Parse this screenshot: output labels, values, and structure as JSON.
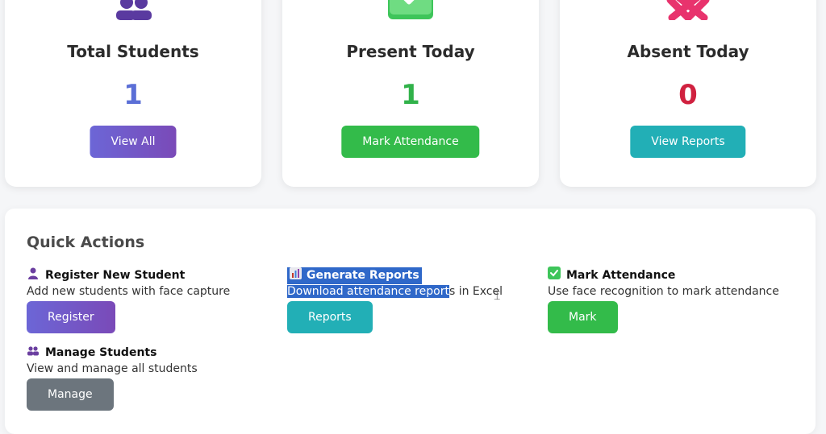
{
  "stats": [
    {
      "title": "Total Students",
      "count": "1",
      "button": "View All",
      "icon": "users-icon",
      "count_color": "#5b6fd6"
    },
    {
      "title": "Present Today",
      "count": "1",
      "button": "Mark Attendance",
      "icon": "check-icon",
      "count_color": "#31b24a"
    },
    {
      "title": "Absent Today",
      "count": "0",
      "button": "View Reports",
      "icon": "cross-icon",
      "count_color": "#d0213f"
    }
  ],
  "quick_actions": {
    "title": "Quick Actions",
    "items": [
      {
        "title": "Register New Student",
        "desc": "Add new students with face capture",
        "button": "Register",
        "icon": "person-icon"
      },
      {
        "title": "Generate Reports",
        "desc_selected": "Download attendance report",
        "desc_rest": "s in Excel",
        "button": "Reports",
        "icon": "bar-chart-icon"
      },
      {
        "title": "Mark Attendance",
        "desc": "Use face recognition to mark attendance",
        "button": "Mark",
        "icon": "checkbox-icon"
      },
      {
        "title": "Manage Students",
        "desc": "View and manage all students",
        "button": "Manage",
        "icon": "people-icon"
      }
    ]
  }
}
